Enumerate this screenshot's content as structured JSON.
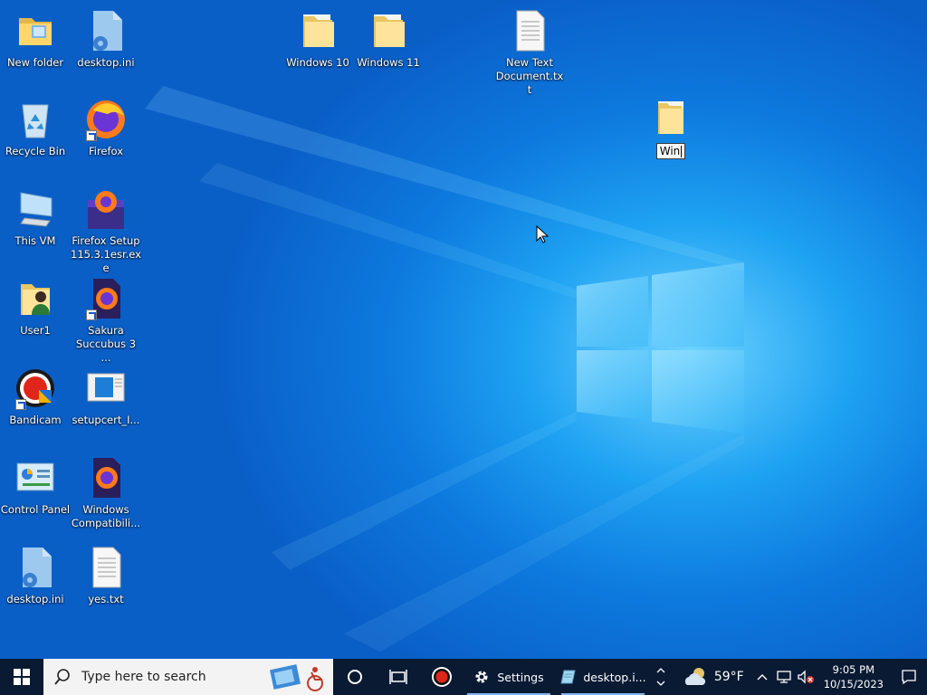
{
  "desktop": {
    "icons": [
      {
        "label": "New folder"
      },
      {
        "label": "desktop.ini"
      },
      {
        "label": "Windows 10"
      },
      {
        "label": "Windows 11"
      },
      {
        "label": "New Text\nDocument.txt"
      },
      {
        "label": "Recycle Bin"
      },
      {
        "label": "Firefox"
      },
      {
        "label": "This VM"
      },
      {
        "label": "Firefox Setup\n115.3.1esr.exe"
      },
      {
        "label": "User1"
      },
      {
        "label": "Sakura\nSuccubus 3 ..."
      },
      {
        "label": "Bandicam"
      },
      {
        "label": "setupcert_I..."
      },
      {
        "label": "Control Panel"
      },
      {
        "label": "Windows\nCompatibili..."
      },
      {
        "label": "desktop.ini"
      },
      {
        "label": "yes.txt"
      }
    ],
    "renaming_folder": {
      "value": "Win"
    }
  },
  "taskbar": {
    "search_placeholder": "Type here to search",
    "apps": [
      {
        "label": "Settings",
        "icon": "gear-icon"
      },
      {
        "label": "desktop.i...",
        "icon": "notepad-icon"
      }
    ],
    "weather": {
      "temp": "59°F",
      "icon": "cloudy-moon-icon"
    },
    "clock": {
      "time": "9:05 PM",
      "date": "10/15/2023"
    }
  }
}
